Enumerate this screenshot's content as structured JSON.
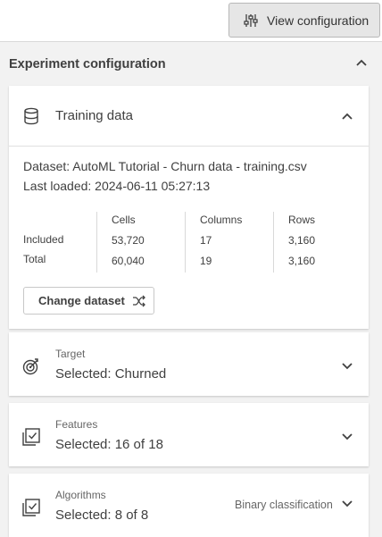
{
  "toolbar": {
    "view_configuration_label": "View configuration",
    "view_configuration_icon": "sliders-icon"
  },
  "panel": {
    "title": "Experiment configuration"
  },
  "training_data": {
    "title": "Training data",
    "icon": "database-icon",
    "dataset_line": "Dataset: AutoML Tutorial - Churn data - training.csv",
    "last_loaded_line": "Last loaded: 2024-06-11 05:27:13",
    "columns": [
      "Cells",
      "Columns",
      "Rows"
    ],
    "rows": [
      {
        "label": "Included",
        "values": [
          "53,720",
          "17",
          "3,160"
        ]
      },
      {
        "label": "Total",
        "values": [
          "60,040",
          "19",
          "3,160"
        ]
      }
    ],
    "change_button_label": "Change dataset",
    "change_button_icon": "shuffle-icon"
  },
  "target": {
    "label": "Target",
    "value": "Selected: Churned",
    "icon": "target-icon"
  },
  "features": {
    "label": "Features",
    "value": "Selected: 16 of 18",
    "icon": "checklist-icon"
  },
  "algorithms": {
    "label": "Algorithms",
    "value": "Selected: 8 of 8",
    "extra": "Binary classification",
    "icon": "checklist-icon"
  }
}
